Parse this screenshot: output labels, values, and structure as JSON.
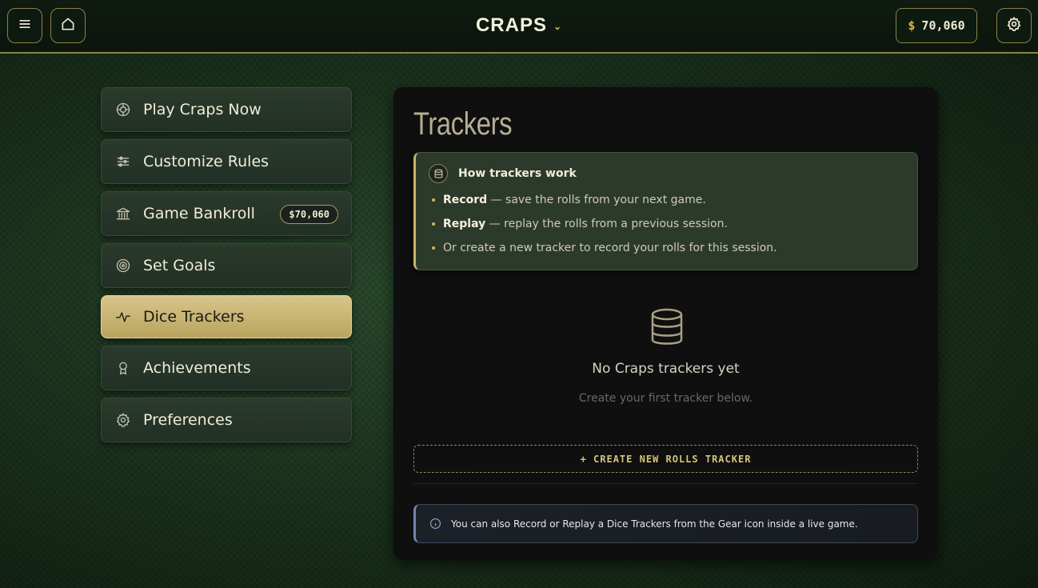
{
  "header": {
    "title": "CRAPS",
    "balance_currency": "$",
    "balance_value": "70,060",
    "icons": [
      "menu-icon",
      "home-icon",
      "chevron-down-icon",
      "gear-icon"
    ]
  },
  "sidebar": {
    "items": [
      {
        "label": "Play Craps Now",
        "icon": "roulette-icon"
      },
      {
        "label": "Customize Rules",
        "icon": "sliders-icon"
      },
      {
        "label": "Game Bankroll",
        "icon": "bank-icon",
        "badge": "$70,060"
      },
      {
        "label": "Set Goals",
        "icon": "target-icon"
      },
      {
        "label": "Dice Trackers",
        "icon": "activity-icon",
        "active": true
      },
      {
        "label": "Achievements",
        "icon": "award-icon"
      },
      {
        "label": "Preferences",
        "icon": "gear-icon"
      }
    ]
  },
  "main": {
    "title": "Trackers",
    "howto": {
      "title": "How trackers work",
      "items": [
        {
          "bold": "Record",
          "text": " — save the rolls from your next game."
        },
        {
          "bold": "Replay",
          "text": " — replay the rolls from a previous session."
        },
        {
          "bold": "",
          "text": "Or create a new tracker to record your rolls for this session."
        }
      ]
    },
    "empty_title": "No Craps trackers yet",
    "empty_subtitle": "Create your first tracker below.",
    "create_button": "+ CREATE NEW ROLLS TRACKER",
    "info_text": "You can also Record or Replay a Dice Trackers from the Gear icon inside a live game."
  },
  "colors": {
    "accent_gold": "#d4b866",
    "active_item": "#c9b26a",
    "info_border": "#6d86b0"
  }
}
